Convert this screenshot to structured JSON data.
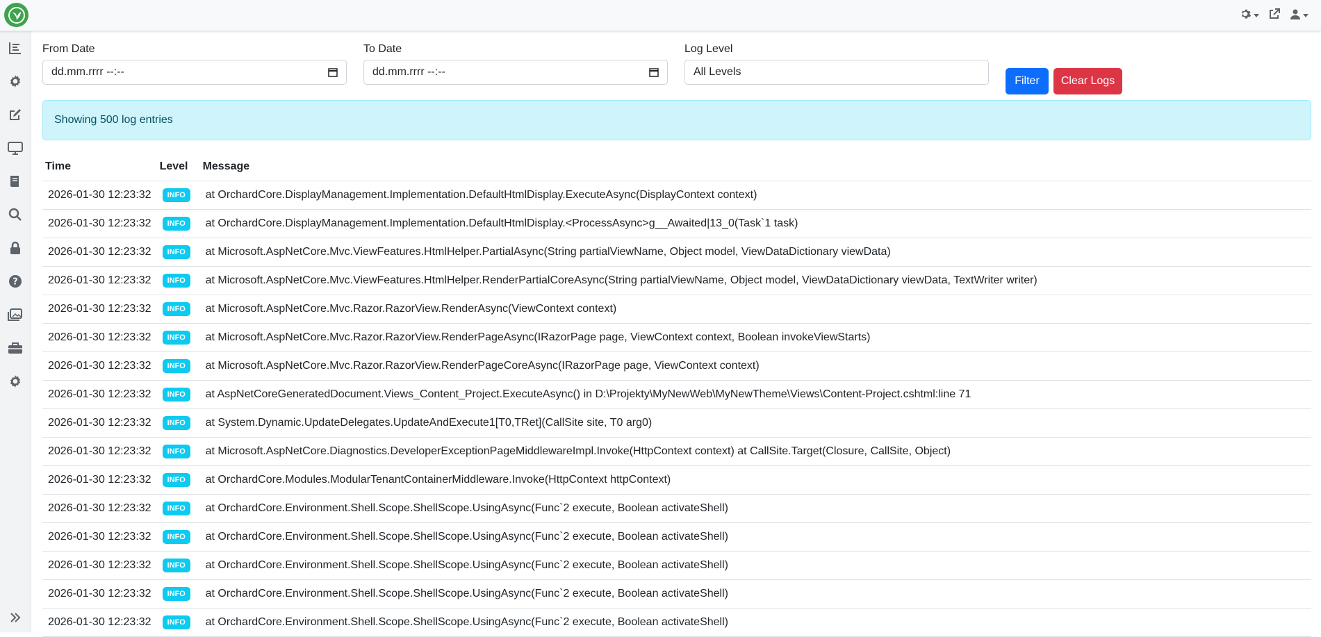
{
  "header": {
    "logo_icon": "leaf-logo-icon",
    "icons": [
      "gear-icon",
      "external-link-icon",
      "user-icon"
    ]
  },
  "sidebar": {
    "items": [
      {
        "icon": "chart-icon"
      },
      {
        "icon": "gear-icon"
      },
      {
        "icon": "edit-icon"
      },
      {
        "icon": "monitor-icon"
      },
      {
        "icon": "book-icon"
      },
      {
        "icon": "search-icon"
      },
      {
        "icon": "lock-icon"
      },
      {
        "icon": "question-icon"
      },
      {
        "icon": "images-icon"
      },
      {
        "icon": "toolbox-icon"
      },
      {
        "icon": "gear-icon"
      }
    ],
    "collapse_icon": "double-chevron-right-icon"
  },
  "filters": {
    "from_label": "From Date",
    "from_placeholder": "dd.mm.rrrr --:--",
    "to_label": "To Date",
    "to_placeholder": "dd.mm.rrrr --:--",
    "level_label": "Log Level",
    "level_value": "All Levels",
    "filter_button": "Filter",
    "clear_button": "Clear Logs"
  },
  "alert": {
    "text": "Showing 500 log entries"
  },
  "table": {
    "headers": {
      "time": "Time",
      "level": "Level",
      "message": "Message"
    },
    "rows": [
      {
        "time": "2026-01-30 12:23:32",
        "level": "INFO",
        "message": "at OrchardCore.DisplayManagement.Implementation.DefaultHtmlDisplay.ExecuteAsync(DisplayContext context)"
      },
      {
        "time": "2026-01-30 12:23:32",
        "level": "INFO",
        "message": "at OrchardCore.DisplayManagement.Implementation.DefaultHtmlDisplay.<ProcessAsync>g__Awaited|13_0(Task`1 task)"
      },
      {
        "time": "2026-01-30 12:23:32",
        "level": "INFO",
        "message": "at Microsoft.AspNetCore.Mvc.ViewFeatures.HtmlHelper.PartialAsync(String partialViewName, Object model, ViewDataDictionary viewData)"
      },
      {
        "time": "2026-01-30 12:23:32",
        "level": "INFO",
        "message": "at Microsoft.AspNetCore.Mvc.ViewFeatures.HtmlHelper.RenderPartialCoreAsync(String partialViewName, Object model, ViewDataDictionary viewData, TextWriter writer)"
      },
      {
        "time": "2026-01-30 12:23:32",
        "level": "INFO",
        "message": "at Microsoft.AspNetCore.Mvc.Razor.RazorView.RenderAsync(ViewContext context)"
      },
      {
        "time": "2026-01-30 12:23:32",
        "level": "INFO",
        "message": "at Microsoft.AspNetCore.Mvc.Razor.RazorView.RenderPageAsync(IRazorPage page, ViewContext context, Boolean invokeViewStarts)"
      },
      {
        "time": "2026-01-30 12:23:32",
        "level": "INFO",
        "message": "at Microsoft.AspNetCore.Mvc.Razor.RazorView.RenderPageCoreAsync(IRazorPage page, ViewContext context)"
      },
      {
        "time": "2026-01-30 12:23:32",
        "level": "INFO",
        "message": "at AspNetCoreGeneratedDocument.Views_Content_Project.ExecuteAsync() in D:\\Projekty\\MyNewWeb\\MyNewTheme\\Views\\Content-Project.cshtml:line 71"
      },
      {
        "time": "2026-01-30 12:23:32",
        "level": "INFO",
        "message": "at System.Dynamic.UpdateDelegates.UpdateAndExecute1[T0,TRet](CallSite site, T0 arg0)"
      },
      {
        "time": "2026-01-30 12:23:32",
        "level": "INFO",
        "message": "at Microsoft.AspNetCore.Diagnostics.DeveloperExceptionPageMiddlewareImpl.Invoke(HttpContext context) at CallSite.Target(Closure, CallSite, Object)"
      },
      {
        "time": "2026-01-30 12:23:32",
        "level": "INFO",
        "message": "at OrchardCore.Modules.ModularTenantContainerMiddleware.Invoke(HttpContext httpContext)"
      },
      {
        "time": "2026-01-30 12:23:32",
        "level": "INFO",
        "message": "at OrchardCore.Environment.Shell.Scope.ShellScope.UsingAsync(Func`2 execute, Boolean activateShell)"
      },
      {
        "time": "2026-01-30 12:23:32",
        "level": "INFO",
        "message": "at OrchardCore.Environment.Shell.Scope.ShellScope.UsingAsync(Func`2 execute, Boolean activateShell)"
      },
      {
        "time": "2026-01-30 12:23:32",
        "level": "INFO",
        "message": "at OrchardCore.Environment.Shell.Scope.ShellScope.UsingAsync(Func`2 execute, Boolean activateShell)"
      },
      {
        "time": "2026-01-30 12:23:32",
        "level": "INFO",
        "message": "at OrchardCore.Environment.Shell.Scope.ShellScope.UsingAsync(Func`2 execute, Boolean activateShell)"
      },
      {
        "time": "2026-01-30 12:23:32",
        "level": "INFO",
        "message": "at OrchardCore.Environment.Shell.Scope.ShellScope.UsingAsync(Func`2 execute, Boolean activateShell)"
      }
    ]
  },
  "colors": {
    "primary": "#0d6efd",
    "danger": "#dc3545",
    "info_badge": "#0dcaf0",
    "alert_bg": "#cff4fc",
    "alert_text": "#055160",
    "logo_green": "#3fa34d"
  }
}
